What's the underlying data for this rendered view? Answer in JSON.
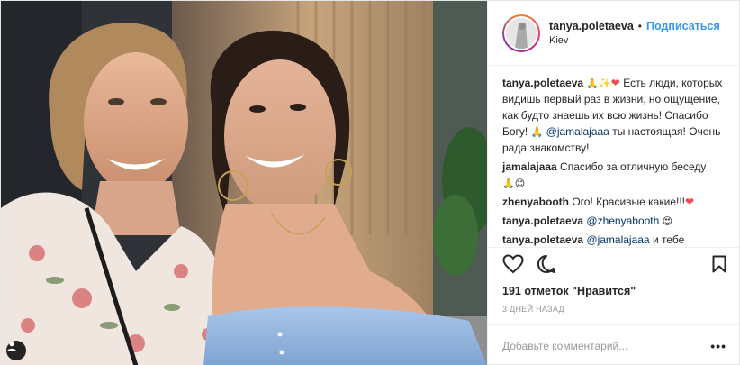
{
  "header": {
    "username": "tanya.poletaeva",
    "separator": "•",
    "follow_label": "Подписаться",
    "location": "Kiev"
  },
  "comments": [
    {
      "user": "tanya.poletaeva",
      "emojis": "🙏✨",
      "heart": "❤",
      "text_a": " Есть люди, которых видишь первый раз в жизни, но ощущение, как будто знаешь их всю жизнь! Спасибо Богу! ",
      "emoji2": "🙏",
      "mention": "@jamalajaaa",
      "text_b": " ты настоящая! Очень рада знакомству!"
    },
    {
      "user": "jamalajaaa",
      "text": " Спасибо за отличную беседу ",
      "emoji": "🙏😊"
    },
    {
      "user": "zhenyabooth",
      "text": " Ого! Красивые какие!!!",
      "heart": "❤"
    },
    {
      "user": "tanya.poletaeva",
      "mention": "@zhenyabooth",
      "emoji": "😍"
    },
    {
      "user": "tanya.poletaeva",
      "mention": "@jamalajaaa",
      "text": " и тебе спасибо большое ",
      "emoji": "☺"
    }
  ],
  "actions": {
    "like_icon": "heart-outline-icon",
    "comment_icon": "comment-bubble-icon",
    "save_icon": "bookmark-icon"
  },
  "likes_text": "191 отметок \"Нравится\"",
  "time_text": "3 дней назад",
  "add_comment": {
    "placeholder": "Добавьте комментарий...",
    "more_label": "•••"
  },
  "colors": {
    "link": "#3897f0",
    "mention": "#003569",
    "heart": "#ed4956",
    "muted": "#999999",
    "border": "#efefef"
  }
}
